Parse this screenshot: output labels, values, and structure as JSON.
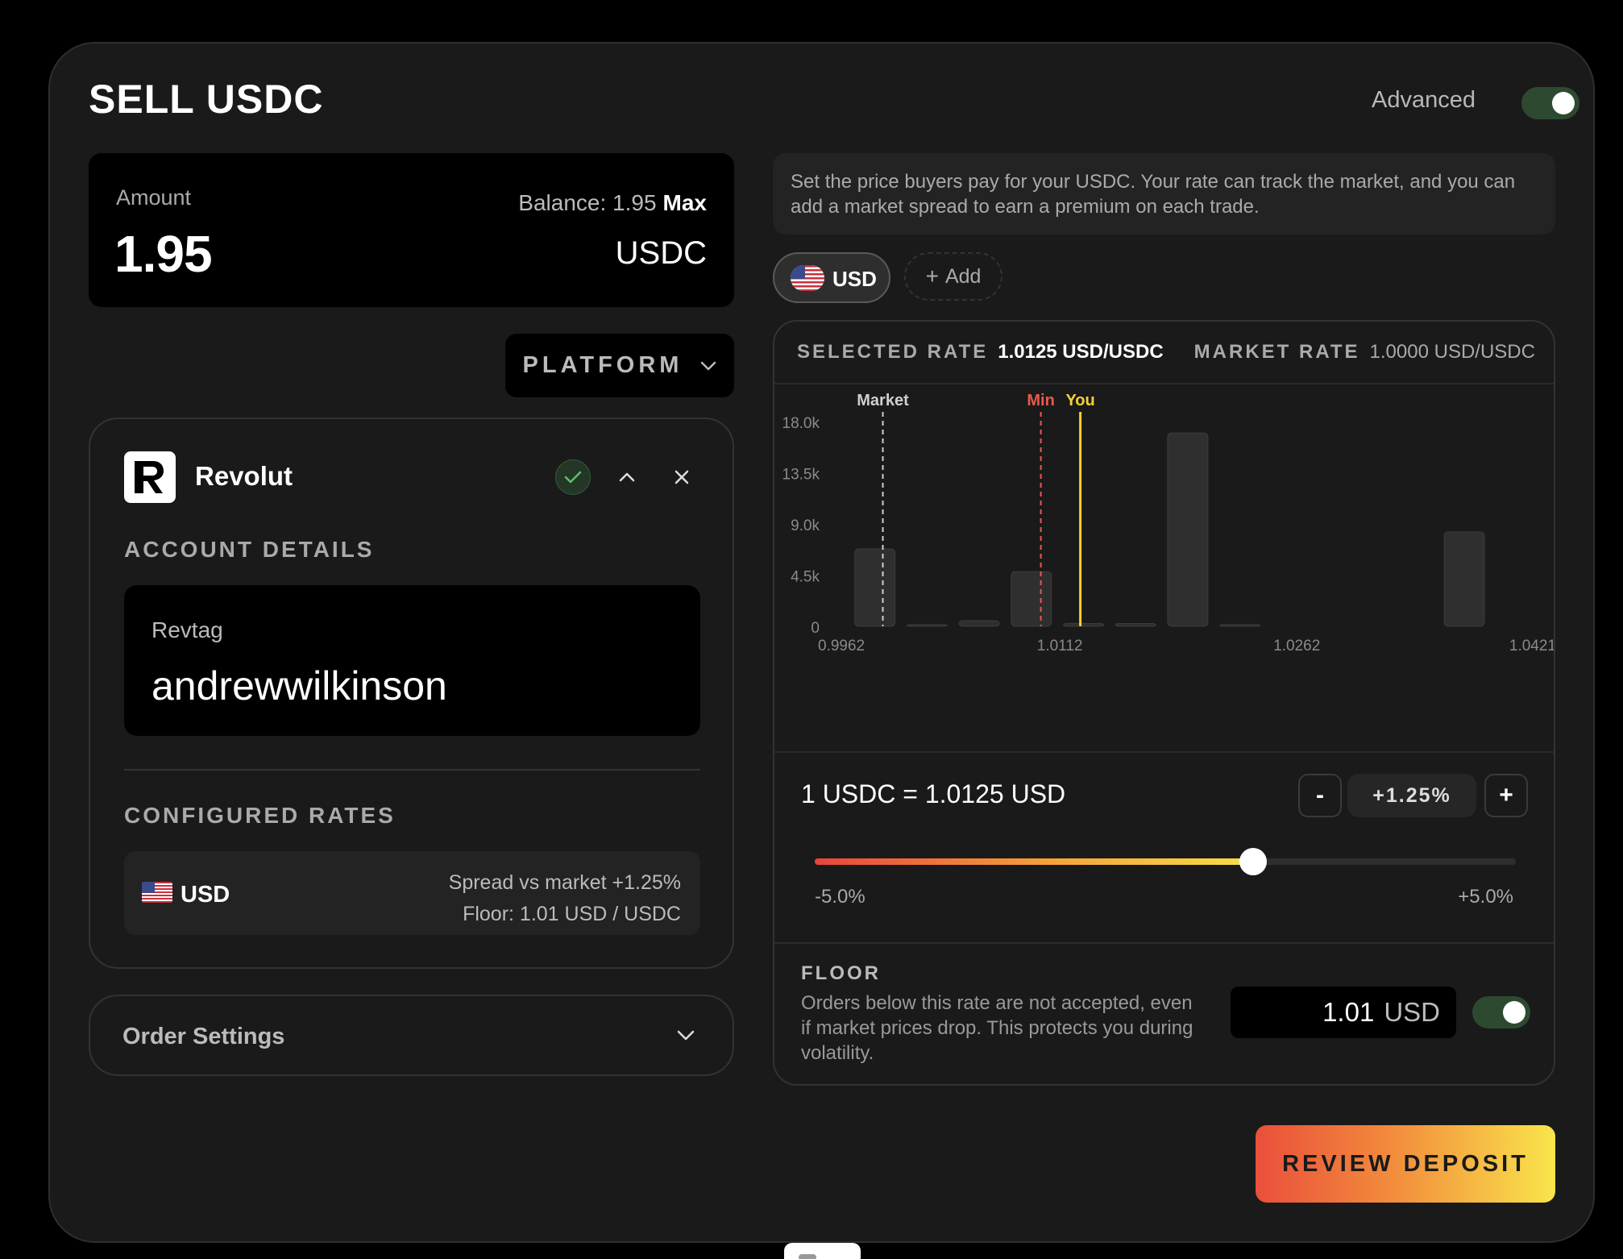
{
  "header": {
    "title": "SELL USDC",
    "advanced_label": "Advanced",
    "advanced_on": true
  },
  "amount": {
    "label": "Amount",
    "value": "1.95",
    "balance_label": "Balance: 1.95",
    "max_label": "Max",
    "unit": "USDC"
  },
  "platform": {
    "label": "PLATFORM"
  },
  "platform_card": {
    "name": "Revolut",
    "account_details_label": "ACCOUNT DETAILS",
    "revtag_label": "Revtag",
    "revtag_value": "andrewwilkinson",
    "configured_rates_label": "CONFIGURED RATES",
    "rate": {
      "currency": "USD",
      "spread_line": "Spread vs market +1.25%",
      "floor_line": "Floor: 1.01 USD / USDC"
    }
  },
  "order_settings": {
    "label": "Order Settings"
  },
  "info_text": "Set the price buyers pay for your USDC. Your rate can track the market, and you can add a market spread to earn a premium on each trade.",
  "currency_chips": {
    "selected": "USD",
    "add_label": "Add"
  },
  "rates": {
    "selected_label": "SELECTED RATE",
    "selected_value": "1.0125 USD/USDC",
    "market_label": "MARKET RATE",
    "market_value": "1.0000 USD/USDC"
  },
  "chart_data": {
    "type": "bar",
    "x_ticks": [
      "0.9962",
      "1.0112",
      "1.0262",
      "1.0421"
    ],
    "y_ticks": [
      "18.0k",
      "13.5k",
      "9.0k",
      "4.5k",
      "0"
    ],
    "ylim": [
      0,
      18000
    ],
    "xlim": [
      0.9962,
      1.0421
    ],
    "bins": [
      {
        "x": 0.9995,
        "value": 6800
      },
      {
        "x": 1.0028,
        "value": 100
      },
      {
        "x": 1.0061,
        "value": 500
      },
      {
        "x": 1.0094,
        "value": 4800
      },
      {
        "x": 1.0127,
        "value": 250
      },
      {
        "x": 1.016,
        "value": 250
      },
      {
        "x": 1.0193,
        "value": 17000
      },
      {
        "x": 1.0226,
        "value": 100
      },
      {
        "x": 1.0368,
        "value": 8300
      }
    ],
    "markers": [
      {
        "label": "Market",
        "x": 1.0,
        "color": "#cfcfcf",
        "dashed": true
      },
      {
        "label": "Min",
        "x": 1.01,
        "color": "#e85a4f",
        "dashed": true
      },
      {
        "label": "You",
        "x": 1.0125,
        "color": "#f2d13a",
        "dashed": false
      }
    ]
  },
  "rate_control": {
    "equation": "1 USDC = 1.0125 USD",
    "minus_label": "-",
    "plus_label": "+",
    "spread_value": "+1.25%",
    "slider_min_label": "-5.0%",
    "slider_max_label": "+5.0%",
    "slider_fraction": 0.625
  },
  "floor": {
    "title": "FLOOR",
    "description": "Orders below this rate are not accepted, even if market prices drop. This protects you during volatility.",
    "value": "1.01",
    "unit": "USD",
    "enabled": true
  },
  "review_button": {
    "label": "REVIEW DEPOSIT"
  },
  "colors": {
    "accent_start": "#ea4f3b",
    "accent_end": "#f9e54b",
    "toggle_on": "#2d4a31"
  }
}
